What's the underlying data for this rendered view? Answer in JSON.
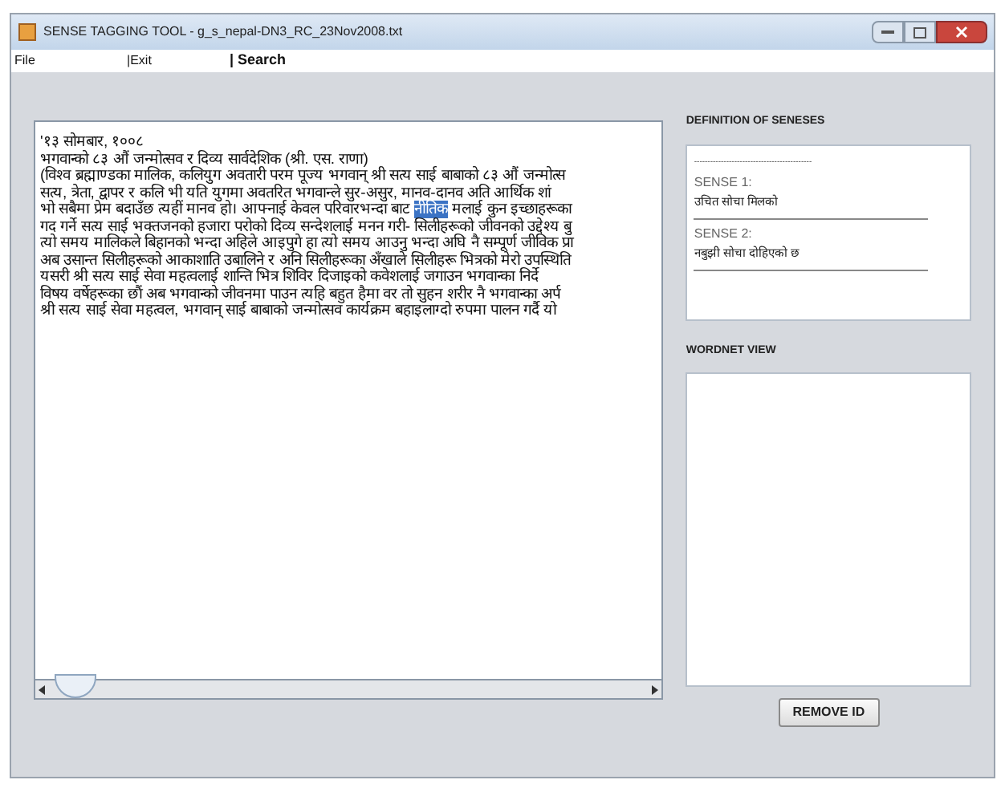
{
  "window": {
    "title": "SENSE TAGGING TOOL  -  g_s_nepal-DN3_RC_23Nov2008.txt"
  },
  "menu": [
    {
      "label": "File"
    },
    {
      "label": "|Exit"
    },
    {
      "label": "| Search"
    }
  ],
  "document": {
    "lines": [
      {
        "segments": [
          {
            "text": "'१३ सोमबार, १००८",
            "selected": false
          }
        ]
      },
      {
        "segments": [
          {
            "text": "भगवान्को ८३ औं जन्मोत्सव र दिव्य सार्वदेशिक (श्री. एस. राणा)",
            "selected": false
          }
        ]
      },
      {
        "segments": [
          {
            "text": "(विश्व ब्रह्माण्डका मालिक, कलियुग अवतारी परम पूज्य भगवान् श्री सत्य साई बाबाको ८३ औं जन्मोत्स",
            "selected": false
          }
        ]
      },
      {
        "segments": [
          {
            "text": "सत्य, त्रेता, द्वापर र कलि भी यति युगमा अवतरित भगवान्ले सुर-असुर, मानव-दानव अति आर्थिक शां",
            "selected": false
          }
        ]
      },
      {
        "segments": [
          {
            "text": "भो सबैमा प्रेम बदाउँछ त्यहीं मानव हो। आफ्नाई केवल परिवारभन्दा बाट ",
            "selected": false
          },
          {
            "text": "नीतिक",
            "selected": true
          },
          {
            "text": " मलाई कुन इच्छाहरूका",
            "selected": false
          }
        ]
      },
      {
        "segments": [
          {
            "text": "गद गर्ने सत्य साई भक्तजनको हजारा परोको दिव्य सन्देशलाई मनन गरी- सिलीहरूको जीवनको उद्देश्य बु",
            "selected": false
          }
        ]
      },
      {
        "segments": [
          {
            "text": "त्यो समय मालिकले बिहानको भन्दा अहिले आइपुगे हा त्यो समय आउनु भन्दा अघि नै सम्पूर्ण जीविक प्रा",
            "selected": false
          }
        ]
      },
      {
        "segments": [
          {
            "text": "अब उसान्त सिलीहरूको आकाशाति उबालिने र अनि सिलीहरूका अँखाले सिलीहरू भित्रको मेरो उपस्थिति",
            "selected": false
          }
        ]
      },
      {
        "segments": [
          {
            "text": "यसरी श्री सत्य साई सेवा महत्वलाई शान्ति भित्र शिविर दिजाइको कवेशलाई जगाउन भगवान्का निर्दे",
            "selected": false
          }
        ]
      },
      {
        "segments": [
          {
            "text": "विषय वर्षेहरूका छौं अब भगवान्को जीवनमा पाउन त्यहि बहुत हैमा वर तो सुहन शरीर नै भगवान्का अर्प",
            "selected": false
          }
        ]
      },
      {
        "segments": [
          {
            "text": "श्री सत्य साई सेवा महत्वल, भगवान् साई बाबाको जन्मोत्सव कार्यक्रम बहाइलाग्दो रुपमा पालन गर्दै यो",
            "selected": false
          }
        ]
      }
    ]
  },
  "definitions": {
    "heading": "DEFINITION OF SENESES",
    "separator": "--------------------------------------------",
    "senses": [
      {
        "label": "SENSE 1:",
        "text": "उचित सोचा मिलको"
      },
      {
        "label": "SENSE 2:",
        "text": "नबुझी सोचा दोहिएको छ"
      }
    ]
  },
  "wordnet": {
    "heading": "WORDNET VIEW"
  },
  "remove_button": {
    "label": "REMOVE ID"
  }
}
